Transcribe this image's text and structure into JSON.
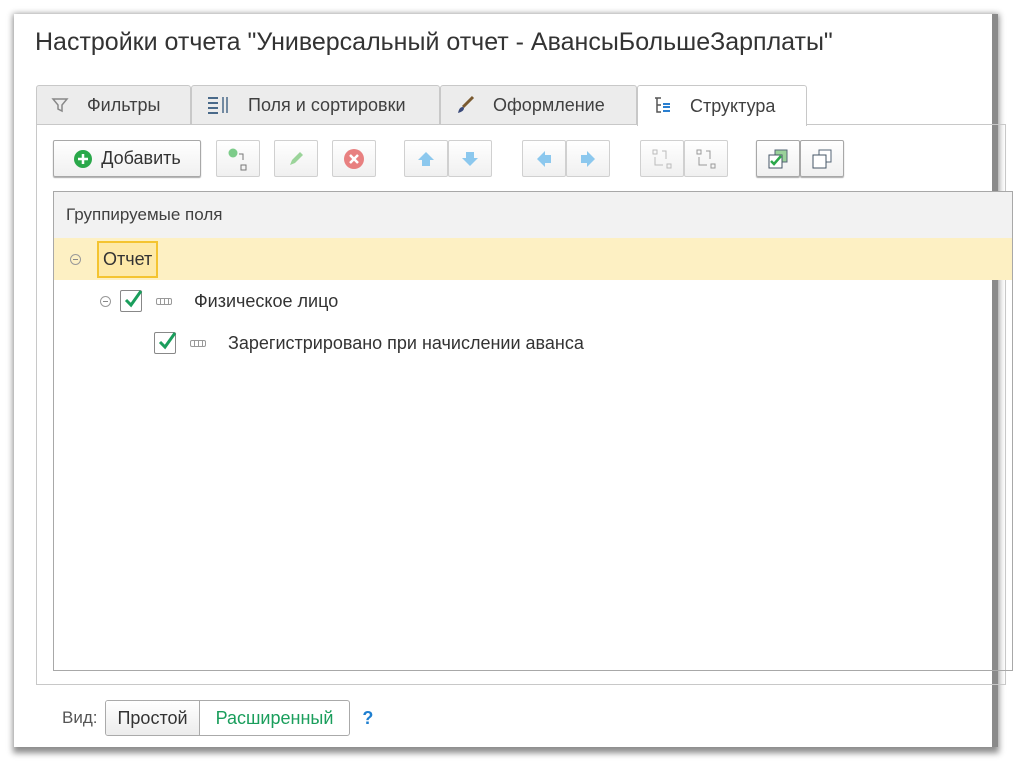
{
  "title": "Настройки отчета \"Универсальный отчет - АвансыБольшеЗарплаты\"",
  "tabs": [
    {
      "label": "Фильтры",
      "icon": "filter-icon"
    },
    {
      "label": "Поля и сортировки",
      "icon": "fields-sort-icon"
    },
    {
      "label": "Оформление",
      "icon": "brush-icon"
    },
    {
      "label": "Структура",
      "icon": "structure-icon",
      "active": true
    }
  ],
  "toolbar": {
    "add_label": "Добавить"
  },
  "grid": {
    "header": "Группируемые поля",
    "rows": [
      {
        "label": "Отчет",
        "level": 0,
        "selected": true
      },
      {
        "label": "Физическое лицо",
        "level": 1,
        "checked": true
      },
      {
        "label": "Зарегистрировано при начислении аванса",
        "level": 2,
        "checked": true
      }
    ]
  },
  "view": {
    "label": "Вид:",
    "options": [
      "Простой",
      "Расширенный"
    ],
    "selected": "Простой",
    "help": "?"
  },
  "colors": {
    "accent_green": "#1a9e5c",
    "selection": "#fdf0c3",
    "help_blue": "#1f7fd0"
  }
}
